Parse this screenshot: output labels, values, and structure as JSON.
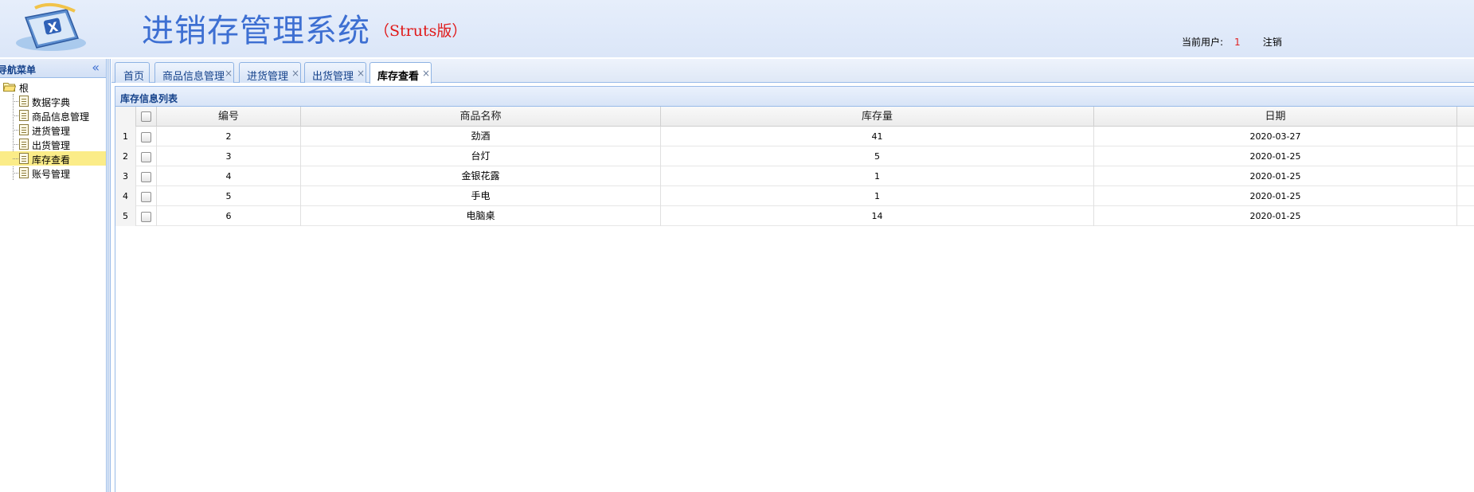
{
  "header": {
    "title": "进销存管理系统",
    "subtitle": "（Struts版）",
    "current_user_label": "当前用户:",
    "current_user_value": "1",
    "logout_label": "注销"
  },
  "sidebar": {
    "title": "导航菜单",
    "root_label": "根",
    "items": [
      {
        "label": "数据字典"
      },
      {
        "label": "商品信息管理"
      },
      {
        "label": "进货管理"
      },
      {
        "label": "出货管理"
      },
      {
        "label": "库存查看",
        "selected": true
      },
      {
        "label": "账号管理"
      }
    ]
  },
  "tabs": [
    {
      "label": "首页",
      "closable": false
    },
    {
      "label": "商品信息管理",
      "closable": true
    },
    {
      "label": "进货管理",
      "closable": true
    },
    {
      "label": "出货管理",
      "closable": true
    },
    {
      "label": "库存查看",
      "closable": true,
      "active": true
    }
  ],
  "panel": {
    "title": "库存信息列表"
  },
  "grid": {
    "columns": [
      "编号",
      "商品名称",
      "库存量",
      "日期"
    ],
    "rows": [
      {
        "num": "1",
        "id": "2",
        "name": "劲酒",
        "stock": "41",
        "date": "2020-03-27"
      },
      {
        "num": "2",
        "id": "3",
        "name": "台灯",
        "stock": "5",
        "date": "2020-01-25"
      },
      {
        "num": "3",
        "id": "4",
        "name": "金银花露",
        "stock": "1",
        "date": "2020-01-25"
      },
      {
        "num": "4",
        "id": "5",
        "name": "手电",
        "stock": "1",
        "date": "2020-01-25"
      },
      {
        "num": "5",
        "id": "6",
        "name": "电脑桌",
        "stock": "14",
        "date": "2020-01-25"
      }
    ]
  },
  "colors": {
    "accent": "#3d6fd2",
    "subtitle": "#e01818",
    "selected_item": "#fbec88",
    "border": "#99bbe8"
  }
}
